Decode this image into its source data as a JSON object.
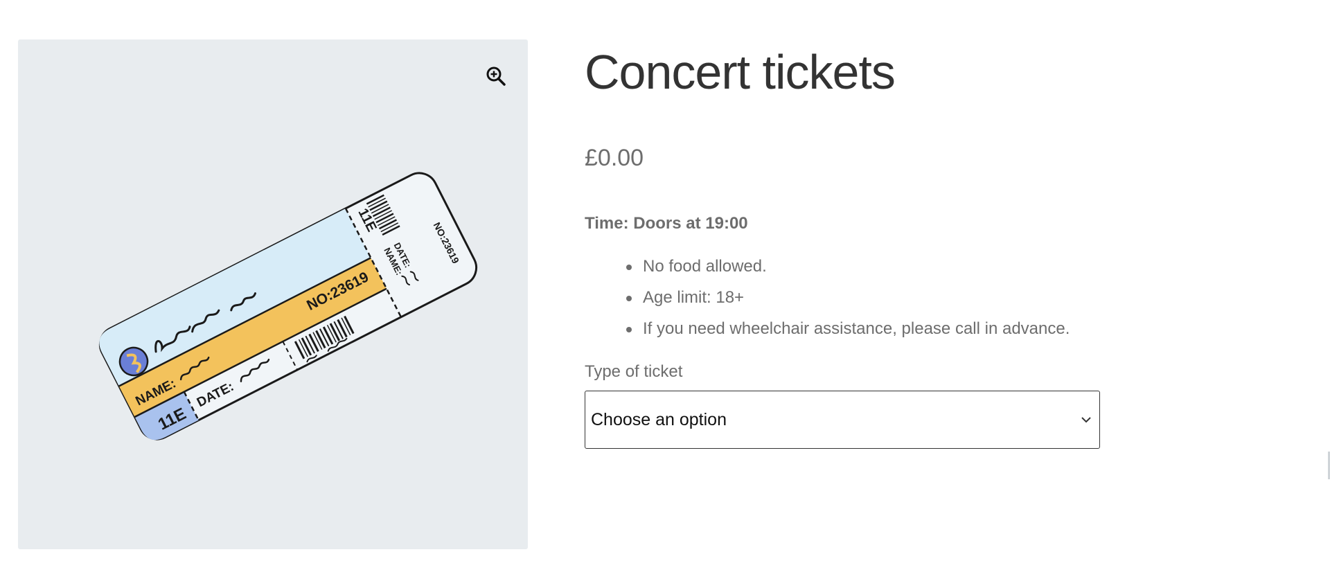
{
  "product": {
    "title": "Concert tickets",
    "price": "£0.00",
    "time_info": "Time: Doors at 19:00",
    "rules": [
      "No food allowed.",
      "Age limit: 18+",
      "If you need wheelchair assistance, please call in advance."
    ]
  },
  "gallery": {
    "zoom_icon": "zoom-in-icon",
    "image_icon": "concert-ticket-illustration",
    "ticket_art": {
      "seat_front": "11E",
      "name_label": "NAME:",
      "date_label": "DATE:",
      "number": "NO:23619",
      "seat_stub": "11E",
      "stub_name": "NAME:",
      "stub_date": "DATE:",
      "stub_number": "NO:23619"
    }
  },
  "variation": {
    "label": "Type of ticket",
    "selected": "Choose an option",
    "dropdown_icon": "chevron-down-icon"
  },
  "colors": {
    "gallery_bg": "#e8ecef",
    "text_dark": "#333333",
    "text_muted": "#6d6d6d",
    "ticket_blue": "#d7ecf8",
    "ticket_yellow": "#f3c25c",
    "ticket_seat": "#a9c2ee"
  }
}
